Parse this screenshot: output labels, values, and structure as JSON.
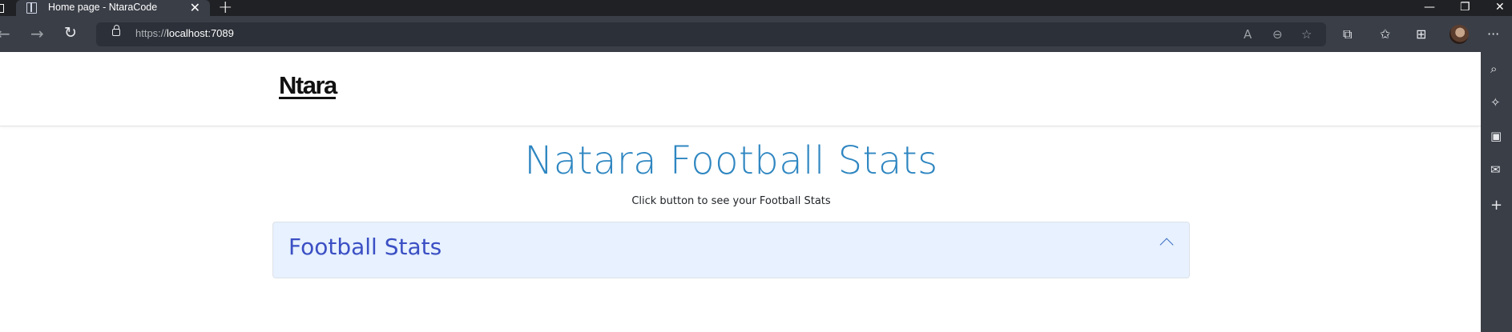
{
  "browser": {
    "tab_title": "Home page - NtaraCode",
    "url_scheme": "https://",
    "url_host": "localhost:7089",
    "icons": {
      "back": "back-arrow-icon",
      "forward": "forward-arrow-icon",
      "refresh": "refresh-icon",
      "lock": "lock-icon",
      "read_aloud": "read-aloud-icon",
      "zoom_out": "zoom-out-icon",
      "add_favorite": "add-favorite-icon",
      "extensions": "extensions-icon",
      "favorites": "favorites-icon",
      "collections": "collections-icon",
      "profile": "avatar",
      "more": "more-icon"
    },
    "sidebar_icons": [
      "search-icon",
      "copilot-icon",
      "office-icon",
      "outlook-icon",
      "add-icon"
    ]
  },
  "site": {
    "logo": "Ntara",
    "title": "Natara Football Stats",
    "subtitle": "Click button to see your Football Stats",
    "accordion_title": "Football Stats"
  },
  "colors": {
    "title": "#2e86c1",
    "accordion_bg": "#e7f1ff",
    "accordion_text": "#3b4fc4",
    "browser_chrome": "#3a3e47"
  }
}
